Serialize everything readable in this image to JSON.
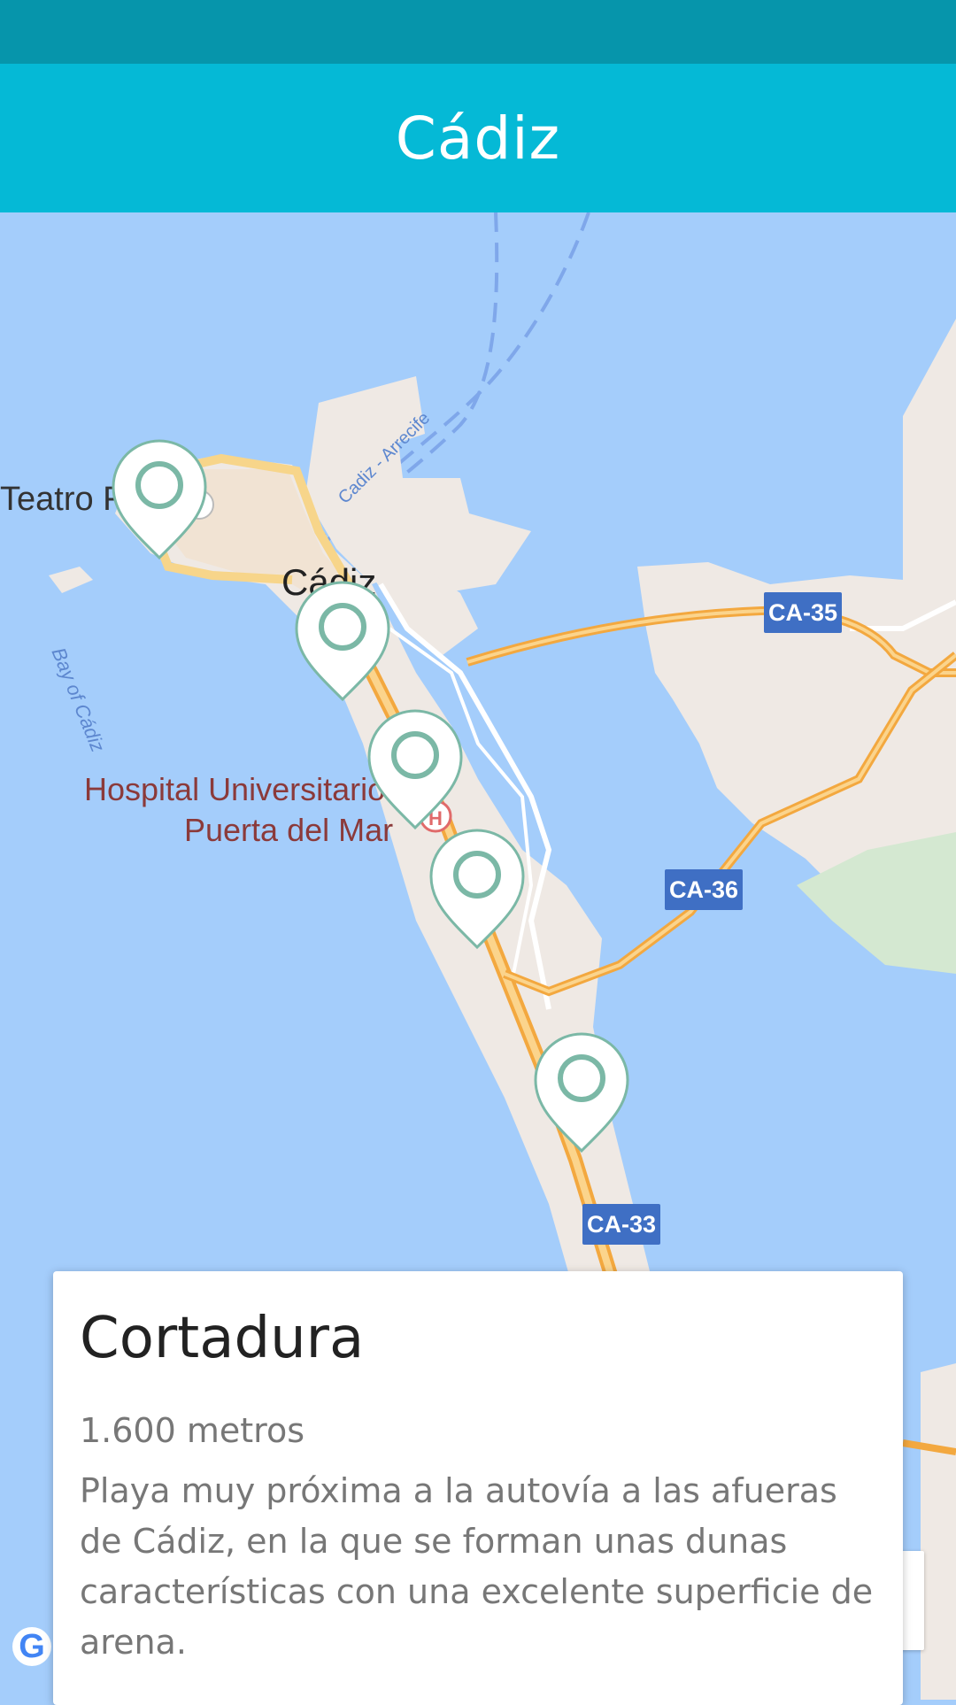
{
  "app": {
    "title": "Cádiz"
  },
  "map": {
    "place_labels": {
      "teatro": "Teatro Falla",
      "city": "Cádiz",
      "bay": "Bay of Cádiz",
      "hospital_line1": "Hospital Universitario",
      "hospital_line2": "Puerta del Mar",
      "ferry_route": "Cadiz - Arrecife"
    },
    "road_shields": {
      "ca35": "CA-35",
      "ca36": "CA-36",
      "ca33": "CA-33"
    },
    "markers_count": 5,
    "colors": {
      "water": "#a4cdfb",
      "land": "#f3eeea",
      "city_area": "#ede6df",
      "highway": "#f5ac47",
      "shield": "#3f6fc4",
      "marker_ring": "#7bb8a6"
    }
  },
  "card": {
    "title": "Cortadura",
    "distance": "1.600 metros",
    "description": "Playa muy próxima a la autovía a las afueras de Cádiz, en la que se forman unas dunas características con una excelente superficie de arena."
  },
  "attribution": {
    "google_letter": "G"
  },
  "colors": {
    "status_bar": "#0695ab",
    "app_bar": "#05b9d6",
    "title_text": "#ffffff"
  }
}
